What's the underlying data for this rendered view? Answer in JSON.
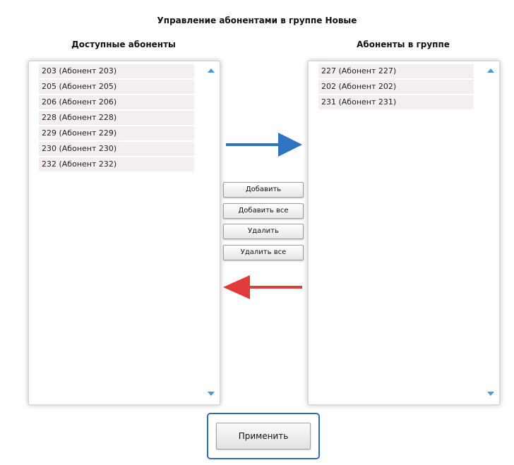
{
  "dialog": {
    "title": "Управление абонентами в группе Новые"
  },
  "available": {
    "heading": "Доступные абоненты",
    "items": [
      "203 (Абонент 203)",
      "205 (Абонент 205)",
      "206 (Абонент 206)",
      "228 (Абонент 228)",
      "229 (Абонент 229)",
      "230 (Абонент 230)",
      "232 (Абонент 232)"
    ]
  },
  "in_group": {
    "heading": "Абоненты в группе",
    "items": [
      "227 (Абонент 227)",
      "202 (Абонент 202)",
      "231 (Абонент 231)"
    ]
  },
  "actions": {
    "add": "Добавить",
    "add_all": "Добавить все",
    "remove": "Удалить",
    "remove_all": "Удалить все",
    "apply": "Применить"
  },
  "colors": {
    "arrow_add": "#2f74c0",
    "arrow_remove": "#e03a3a",
    "scroll_arrow": "#3d9fd9",
    "item_bg": "#f5eeee",
    "apply_focus": "#2d6fb7"
  },
  "icons": {
    "add_direction": "arrow-right-icon",
    "remove_direction": "arrow-left-icon",
    "scroll_up": "scroll-up-icon",
    "scroll_down": "scroll-down-icon"
  }
}
